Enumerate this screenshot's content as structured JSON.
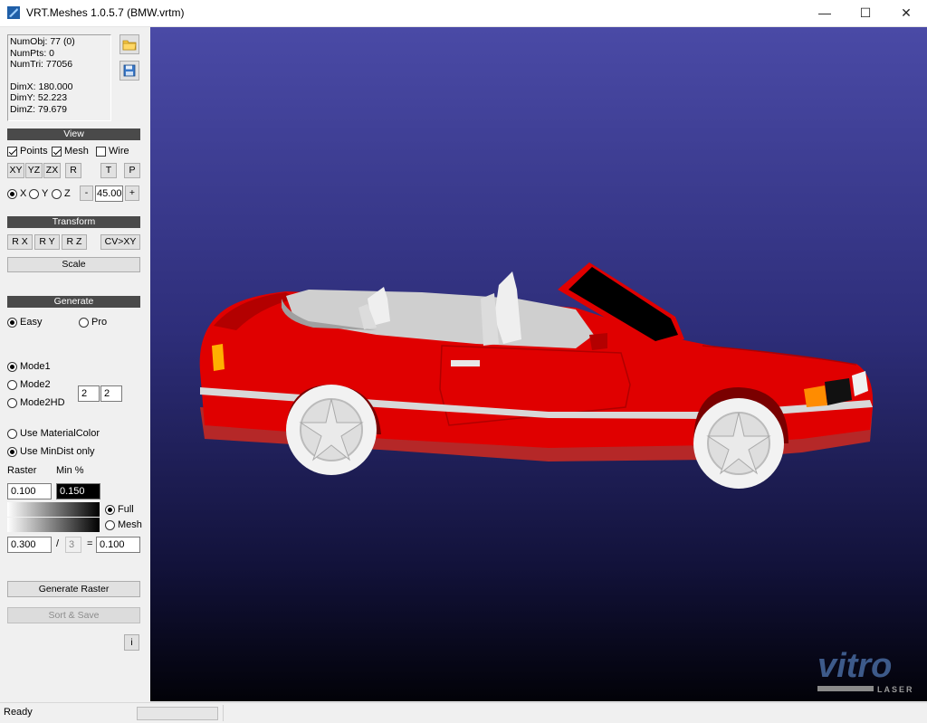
{
  "window": {
    "title": "VRT.Meshes 1.0.5.7 (BMW.vrtm)",
    "minimize_glyph": "—",
    "maximize_glyph": "☐",
    "close_glyph": "✕"
  },
  "info": {
    "numobj": "NumObj: 77 (0)",
    "numpts": "NumPts: 0",
    "numtri": "NumTri: 77056",
    "dimx": "DimX: 180.000",
    "dimy": "DimY: 52.223",
    "dimz": "DimZ: 79.679"
  },
  "view": {
    "header": "View",
    "points": "Points",
    "mesh": "Mesh",
    "wire": "Wire",
    "points_checked": true,
    "mesh_checked": true,
    "wire_checked": false,
    "btn_xy": "XY",
    "btn_yz": "YZ",
    "btn_zx": "ZX",
    "btn_r": "R",
    "btn_t": "T",
    "btn_p": "P",
    "axis_x": "X",
    "axis_y": "Y",
    "axis_z": "Z",
    "selected_axis": "X",
    "minus": "-",
    "plus": "+",
    "angle": "45.00"
  },
  "transform": {
    "header": "Transform",
    "rx": "R X",
    "ry": "R Y",
    "rz": "R Z",
    "cvxy": "CV>XY",
    "scale": "Scale"
  },
  "generate": {
    "header": "Generate",
    "easy": "Easy",
    "pro": "Pro",
    "mode1": "Mode1",
    "mode2": "Mode2",
    "mode2hd": "Mode2HD",
    "mode_val1": "2",
    "mode_val2": "2",
    "use_material_color": "Use MaterialColor",
    "use_mindist": "Use MinDist only",
    "raster_label": "Raster",
    "min_label": "Min %",
    "raster_value": "0.100",
    "min_value": "0.150",
    "full": "Full",
    "mesh": "Mesh",
    "calc_a": "0.300",
    "slash": "/",
    "calc_b": "3",
    "equals": "=",
    "calc_result": "0.100",
    "generate_raster": "Generate Raster",
    "sort_save": "Sort & Save",
    "info_btn": "i"
  },
  "status": {
    "text": "Ready"
  },
  "logo": {
    "text": "vitro",
    "sub": "LASER"
  },
  "colors": {
    "car_body": "#e00000",
    "interior": "#dcdcdc",
    "viewport_top": "#4a4aa6",
    "viewport_bottom": "#020208"
  }
}
